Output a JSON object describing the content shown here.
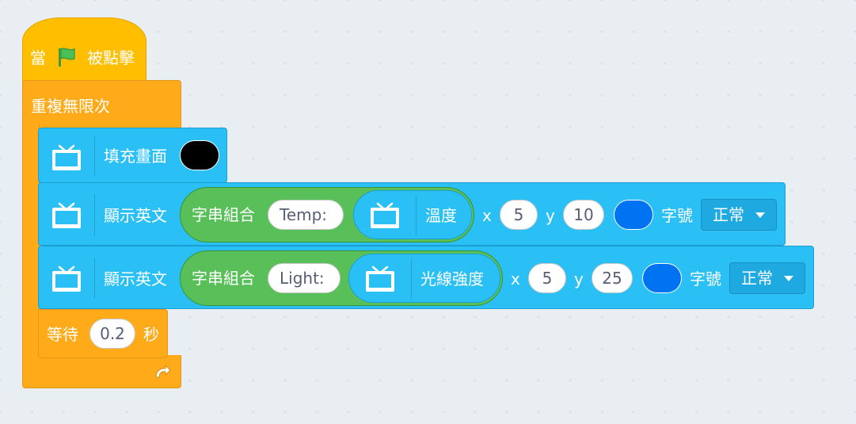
{
  "hat": {
    "when_label": "當",
    "clicked_label": "被點擊",
    "flag_icon": "green-flag-icon"
  },
  "loop": {
    "label": "重複無限次",
    "loop_icon": "loop-arrow-icon"
  },
  "fill_block": {
    "label": "填充畫面",
    "color": "#000000"
  },
  "show_blocks": [
    {
      "label": "顯示英文",
      "join_label": "字串組合",
      "text": "Temp:",
      "reporter_label": "溫度",
      "x_label": "x",
      "x_value": "5",
      "y_label": "y",
      "y_value": "10",
      "color": "#0073f2",
      "size_label": "字號",
      "size_value": "正常"
    },
    {
      "label": "顯示英文",
      "join_label": "字串組合",
      "text": "Light:",
      "reporter_label": "光線強度",
      "x_label": "x",
      "x_value": "5",
      "y_label": "y",
      "y_value": "25",
      "color": "#0073f2",
      "size_label": "字號",
      "size_value": "正常"
    }
  ],
  "wait_block": {
    "label": "等待",
    "value": "0.2",
    "unit": "秒"
  },
  "colors": {
    "hat": "#ffbf00",
    "control": "#ffab19",
    "display": "#2bc0f5",
    "operator": "#59c059"
  }
}
